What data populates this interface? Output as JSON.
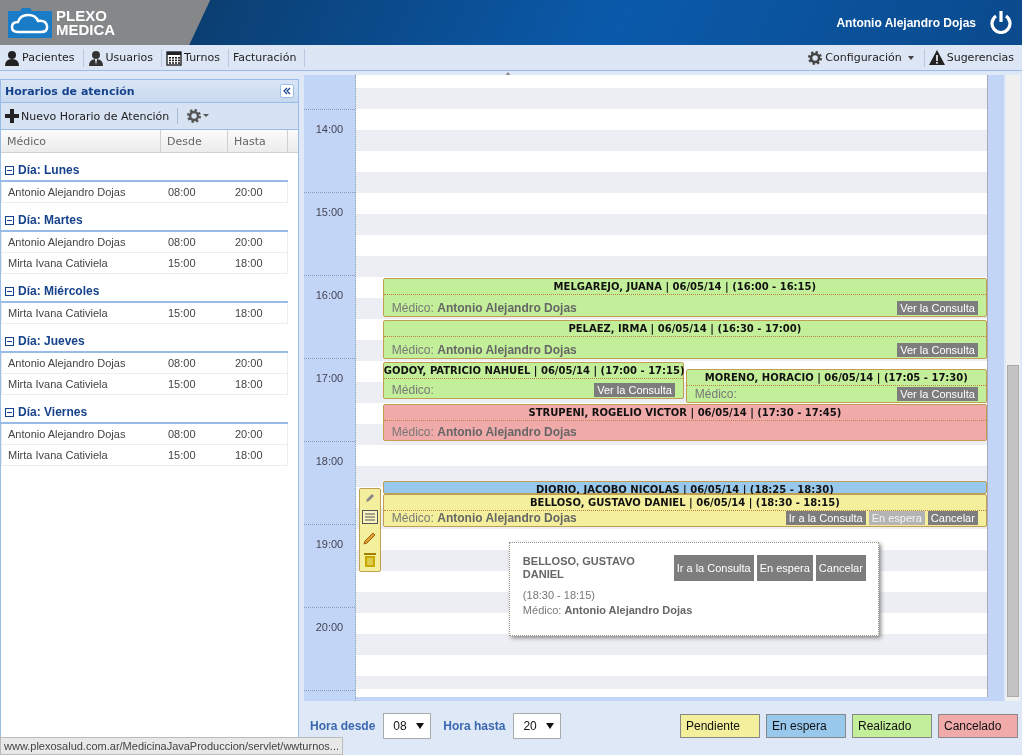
{
  "header": {
    "logo_line_1": "PLEXO",
    "logo_line_2": "MEDICA",
    "user_name": "Antonio Alejandro Dojas"
  },
  "nav": {
    "left": [
      {
        "label": "Pacientes"
      },
      {
        "label": "Usuarios"
      },
      {
        "label": "Turnos"
      },
      {
        "label": "Facturación"
      }
    ],
    "right": [
      {
        "label": "Configuración",
        "dropdown": true
      },
      {
        "label": "Sugerencias",
        "dropdown": false
      }
    ]
  },
  "schedule_panel": {
    "title": "Horarios de atención",
    "new_button": "Nuevo Horario de Atención",
    "columns": [
      "Médico",
      "Desde",
      "Hasta"
    ],
    "groups": [
      {
        "label": "Día: Lunes",
        "expanded": true,
        "rows": [
          [
            "Antonio Alejandro Dojas",
            "08:00",
            "20:00"
          ]
        ]
      },
      {
        "label": "Día: Martes",
        "expanded": true,
        "rows": [
          [
            "Antonio Alejandro Dojas",
            "08:00",
            "20:00"
          ],
          [
            "Mirta Ivana Cativiela",
            "15:00",
            "18:00"
          ]
        ]
      },
      {
        "label": "Día: Miércoles",
        "expanded": true,
        "rows": [
          [
            "Mirta Ivana Cativiela",
            "15:00",
            "18:00"
          ]
        ]
      },
      {
        "label": "Día: Jueves",
        "expanded": true,
        "rows": [
          [
            "Antonio Alejandro Dojas",
            "08:00",
            "20:00"
          ],
          [
            "Mirta Ivana Cativiela",
            "15:00",
            "18:00"
          ]
        ]
      },
      {
        "label": "Día: Viernes",
        "expanded": true,
        "rows": [
          [
            "Antonio Alejandro Dojas",
            "08:00",
            "20:00"
          ],
          [
            "Mirta Ivana Cativiela",
            "15:00",
            "18:00"
          ]
        ]
      }
    ]
  },
  "calendar": {
    "hours": [
      "14:00",
      "15:00",
      "16:00",
      "17:00",
      "18:00",
      "19:00",
      "20:00"
    ],
    "events": [
      {
        "title": "MELGAREJO, JUANA | 06/05/14 | (16:00 - 16:15)",
        "color": "#c3ef9a",
        "doctor_label": "Médico:",
        "doctor": "Antonio Alejandro Dojas",
        "buttons": [
          {
            "label": "Ver la Consulta",
            "disabled": false
          }
        ]
      },
      {
        "title": "PELAEZ, IRMA | 06/05/14 | (16:30 - 17:00)",
        "color": "#c3ef9a",
        "doctor_label": "Médico:",
        "doctor": "Antonio Alejandro Dojas",
        "buttons": [
          {
            "label": "Ver la Consulta",
            "disabled": false
          }
        ]
      },
      {
        "title": "GODOY, PATRICIO NAHUEL | 06/05/14 | (17:00 - 17:15)",
        "color": "#c3ef9a",
        "doctor_label": "Médico:",
        "buttons": [
          {
            "label": "Ver la Consulta",
            "disabled": false
          }
        ]
      },
      {
        "title": "MORENO, HORACIO | 06/05/14 | (17:05 - 17:30)",
        "color": "#c3ef9a",
        "doctor_label": "Médico:",
        "buttons": [
          {
            "label": "Ver la Consulta",
            "disabled": false
          }
        ]
      },
      {
        "title": "STRUPENI, ROGELIO VICTOR | 06/05/14 | (17:30 - 17:45)",
        "color": "#f0aaaa",
        "doctor_label": "Médico:",
        "doctor": "Antonio Alejandro Dojas"
      },
      {
        "title": "DIORIO, JACOBO NICOLAS | 06/05/14 | (18:25 - 18:30)",
        "color": "#98c8ec"
      },
      {
        "title": "BELLOSO, GUSTAVO DANIEL | 06/05/14 | (18:30 - 18:15)",
        "color": "#f3ef9c",
        "doctor_label": "Médico:",
        "doctor": "Antonio Alejandro Dojas",
        "buttons": [
          {
            "label": "Ir a la Consulta",
            "disabled": false
          },
          {
            "label": "En espera",
            "disabled": true
          },
          {
            "label": "Cancelar",
            "disabled": false
          }
        ]
      }
    ],
    "popup": {
      "patient": "BELLOSO, GUSTAVO DANIEL",
      "time": "(18:30 - 18:15)",
      "doctor_label": "Médico:",
      "doctor": "Antonio Alejandro Dojas",
      "buttons": [
        {
          "label": "Ir a la Consulta",
          "disabled": false
        },
        {
          "label": "En espera",
          "disabled": false
        },
        {
          "label": "Cancelar",
          "disabled": false
        }
      ]
    }
  },
  "filters": {
    "from_label": "Hora desde",
    "from_value": "08",
    "to_label": "Hora hasta",
    "to_value": "20"
  },
  "legend": [
    {
      "label": "Pendiente",
      "color": "#f3ef9c"
    },
    {
      "label": "En espera",
      "color": "#98c8ec"
    },
    {
      "label": "Realizado",
      "color": "#c3ef9a"
    },
    {
      "label": "Cancelado",
      "color": "#f0aaaa"
    }
  ],
  "status_url": "www.plexosalud.com.ar/MedicinaJavaProduccion/servlet/wwturnos..."
}
